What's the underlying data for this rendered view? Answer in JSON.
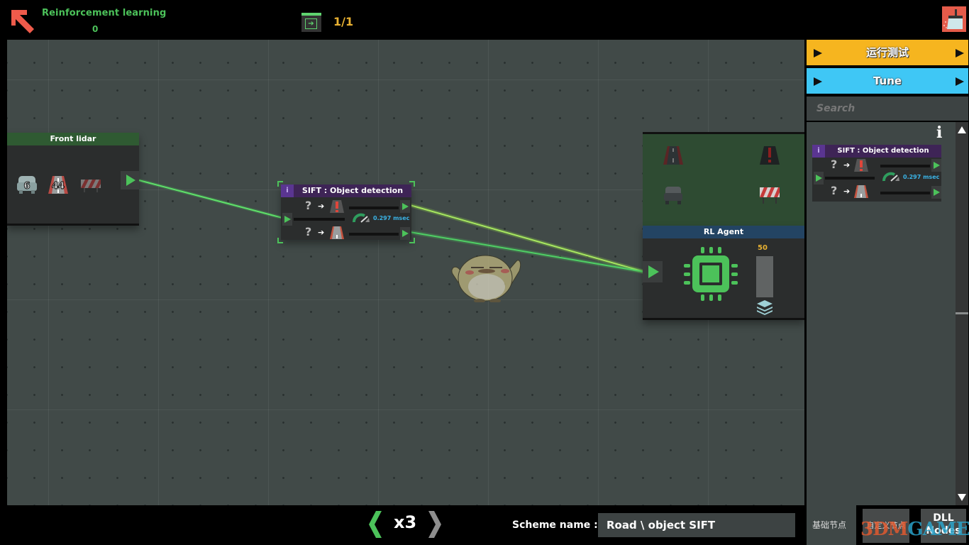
{
  "header": {
    "level_title": "Reinforcement learning",
    "level_score": "0",
    "page_counter": "1/1",
    "back_icon": "arrow-up-left-icon",
    "exit_icon": "exit-door-icon",
    "clear_icon": "broom-icon"
  },
  "canvas": {
    "nodes": {
      "front_lidar": {
        "title": "Front lidar",
        "items": [
          {
            "icon": "car-icon",
            "badge": "6"
          },
          {
            "icon": "road-icon",
            "badge": "44"
          },
          {
            "icon": "barrier-icon",
            "badge": ""
          }
        ]
      },
      "sift": {
        "info": "i",
        "title": "SIFT : Object detection",
        "row1": {
          "unknown": "?",
          "arrow": "➔",
          "icon": "obstacle-road-icon"
        },
        "row2": {
          "unknown": "?",
          "arrow": "➔",
          "icon": "road-icon"
        },
        "timing": "0.297 msec"
      },
      "sensors": {
        "items": [
          "road-icon",
          "obstacle-road-icon",
          "car-icon",
          "barrier-icon"
        ]
      },
      "rl_agent": {
        "title": "RL Agent",
        "epochs": "50",
        "epoch_fill": 1.0,
        "cpu_icon": "cpu-chip-icon",
        "layers_icon": "layers-icon"
      }
    }
  },
  "sidebar": {
    "run_button": "运行测试",
    "tune_button": "Tune",
    "search_placeholder": "Search",
    "info_label": "i",
    "library": [
      {
        "info": "i",
        "title": "SIFT : Object detection",
        "timing": "0.297 msec",
        "row1": {
          "unknown": "?",
          "arrow": "➔"
        },
        "row2": {
          "unknown": "?",
          "arrow": "➔"
        }
      }
    ]
  },
  "footer": {
    "speed": "x3",
    "scheme_label": "Scheme name :",
    "scheme_name": "Road \\ object SIFT",
    "tabs": {
      "basic": "基础节点",
      "custom": "自定义节点",
      "dll_line1": "DLL",
      "dll_line2": "Nodes"
    },
    "watermark_a": "3DM",
    "watermark_b": "GAME"
  },
  "colors": {
    "accent_green": "#4cc25a",
    "run_orange": "#f6b51f",
    "tune_blue": "#3fc7f5",
    "timing_blue": "#3ab3e6",
    "counter_gold": "#e8b132",
    "danger_red": "#e45b4a"
  }
}
